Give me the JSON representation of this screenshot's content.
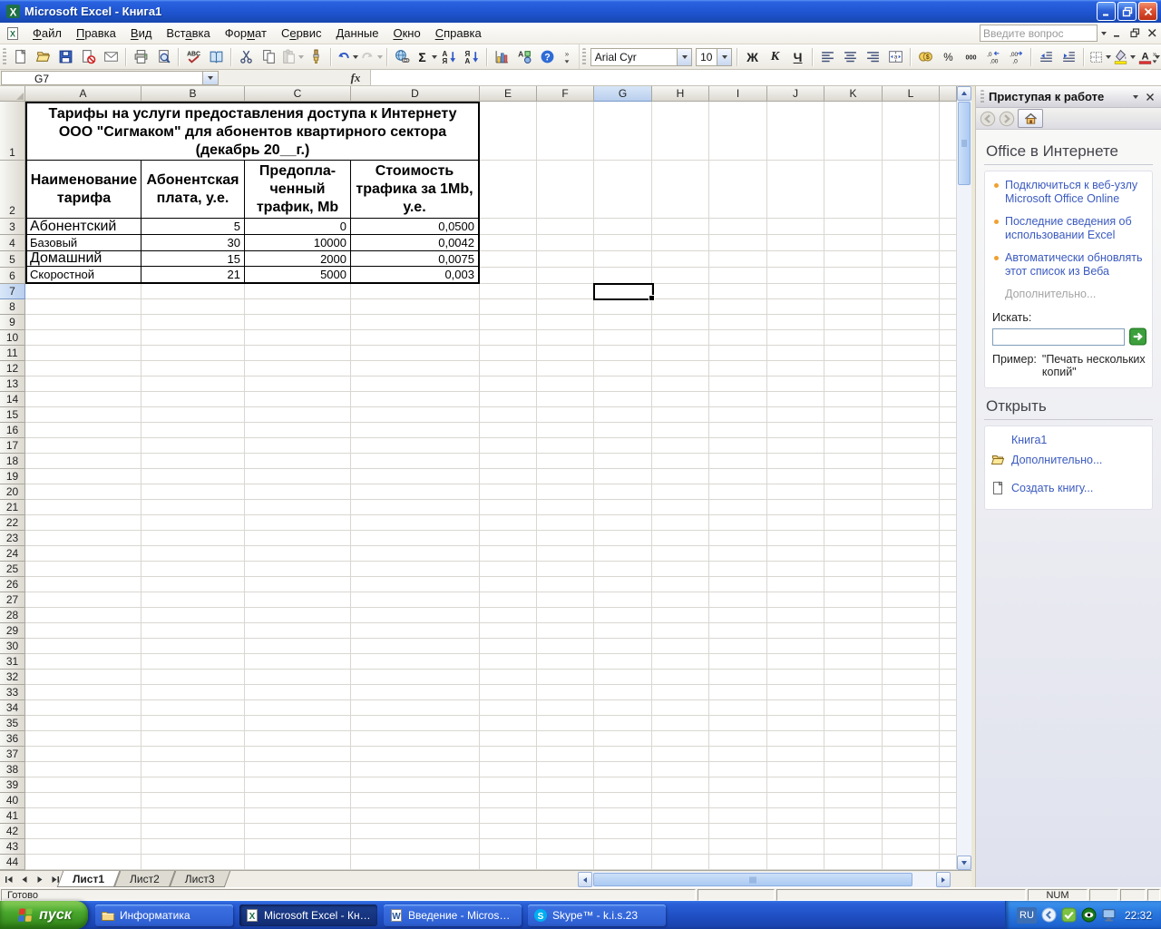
{
  "titlebar": {
    "title": "Microsoft Excel - Книга1"
  },
  "menubar": {
    "items": [
      {
        "label": "Файл",
        "u": 0
      },
      {
        "label": "Правка",
        "u": 0
      },
      {
        "label": "Вид",
        "u": 0
      },
      {
        "label": "Вставка",
        "u": 3
      },
      {
        "label": "Формат",
        "u": 3
      },
      {
        "label": "Сервис",
        "u": 1
      },
      {
        "label": "Данные",
        "u": 0
      },
      {
        "label": "Окно",
        "u": 0
      },
      {
        "label": "Справка",
        "u": 0
      }
    ],
    "question_placeholder": "Введите вопрос"
  },
  "toolbar_standard": [
    {
      "icon": "new"
    },
    {
      "icon": "open"
    },
    {
      "icon": "save"
    },
    {
      "icon": "permission"
    },
    {
      "icon": "email"
    },
    {
      "sep": true
    },
    {
      "icon": "print"
    },
    {
      "icon": "preview"
    },
    {
      "sep": true
    },
    {
      "icon": "spelling"
    },
    {
      "icon": "research"
    },
    {
      "sep": true
    },
    {
      "icon": "cut"
    },
    {
      "icon": "copy"
    },
    {
      "icon": "paste",
      "dd": true,
      "disabled": true
    },
    {
      "icon": "format-painter"
    },
    {
      "sep": true
    },
    {
      "icon": "undo",
      "dd": true
    },
    {
      "icon": "redo",
      "dd": true,
      "disabled": true
    },
    {
      "sep": true
    },
    {
      "icon": "hyperlink"
    },
    {
      "icon": "autosum",
      "dd": true
    },
    {
      "icon": "sort-asc"
    },
    {
      "icon": "sort-desc"
    },
    {
      "sep": true
    },
    {
      "icon": "chart-wizard"
    },
    {
      "icon": "drawing"
    },
    {
      "icon": "help"
    }
  ],
  "formatting": {
    "font_name": "Arial Cyr",
    "font_size": "10",
    "bold_label": "Ж",
    "italic_label": "К",
    "underline_label": "Ч",
    "buttons": [
      {
        "icon": "align-left"
      },
      {
        "icon": "align-center"
      },
      {
        "icon": "align-right"
      },
      {
        "icon": "merge-center"
      },
      {
        "sep": true
      },
      {
        "icon": "currency"
      },
      {
        "icon": "percent"
      },
      {
        "icon": "comma"
      },
      {
        "icon": "inc-decimal"
      },
      {
        "icon": "dec-decimal"
      },
      {
        "sep": true
      },
      {
        "icon": "dec-indent"
      },
      {
        "icon": "inc-indent"
      },
      {
        "sep": true
      },
      {
        "icon": "borders",
        "dd": true
      },
      {
        "icon": "fill-color",
        "dd": true
      },
      {
        "icon": "font-color",
        "dd": true
      }
    ]
  },
  "formula_bar": {
    "cell_reference": "G7",
    "fx_label": "fx",
    "formula_value": ""
  },
  "grid": {
    "columns": [
      "A",
      "B",
      "C",
      "D",
      "E",
      "F",
      "G",
      "H",
      "I",
      "J",
      "K",
      "L"
    ],
    "selected_column": "G",
    "selected_row": 7,
    "total_rows": 44,
    "sheet": {
      "title_lines": [
        "Тарифы на услуги предоставления доступа к Интернету",
        "ООО \"Сигмаком\" для абонентов квартирного сектора",
        "(декабрь 20__г.)"
      ],
      "table_headers": [
        "Наименование тарифа",
        "Абонентская плата, у.е.",
        "Предопла-ченный трафик, Mb",
        "Стоимость трафика за 1Mb, у.е."
      ],
      "table_rows": [
        {
          "name": "Абонентский",
          "fee": "5",
          "traffic": "0",
          "cost": "0,0500",
          "big": true
        },
        {
          "name": "Базовый",
          "fee": "30",
          "traffic": "10000",
          "cost": "0,0042",
          "big": false
        },
        {
          "name": "Домашний",
          "fee": "15",
          "traffic": "2000",
          "cost": "0,0075",
          "big": true
        },
        {
          "name": "Скоростной",
          "fee": "21",
          "traffic": "5000",
          "cost": "0,003",
          "big": false
        }
      ]
    }
  },
  "sheet_tabs": {
    "tabs": [
      "Лист1",
      "Лист2",
      "Лист3"
    ],
    "active_index": 0
  },
  "status_bar": {
    "mode": "Готово",
    "num_indicator": "NUM"
  },
  "task_pane": {
    "title": "Приступая к работе",
    "section1_title": "Office в Интернете",
    "links": [
      "Подключиться к веб-узлу Microsoft Office Online",
      "Последние сведения об использовании Excel",
      "Автоматически обновлять этот список из Веба"
    ],
    "more_label": "Дополнительно...",
    "search_label": "Искать:",
    "example_label": "Пример:",
    "example_text": "\"Печать нескольких копий\"",
    "section2_title": "Открыть",
    "open_links": [
      {
        "label": "Книга1",
        "icon": ""
      },
      {
        "label": "Дополнительно...",
        "icon": "open-folder"
      },
      {
        "label": "Создать книгу...",
        "icon": "new-doc"
      }
    ]
  },
  "taskbar": {
    "start_label": "пуск",
    "buttons": [
      {
        "label": "Информатика",
        "icon": "folder",
        "active": false
      },
      {
        "label": "Microsoft Excel - Кни...",
        "icon": "excel-doc",
        "active": true
      },
      {
        "label": "Введение - Microsoft...",
        "icon": "word-doc",
        "active": false
      },
      {
        "label": "Skype™ - k.i.s.23",
        "icon": "skype",
        "active": false
      }
    ],
    "tray": {
      "language": "RU",
      "time": "22:32"
    }
  }
}
